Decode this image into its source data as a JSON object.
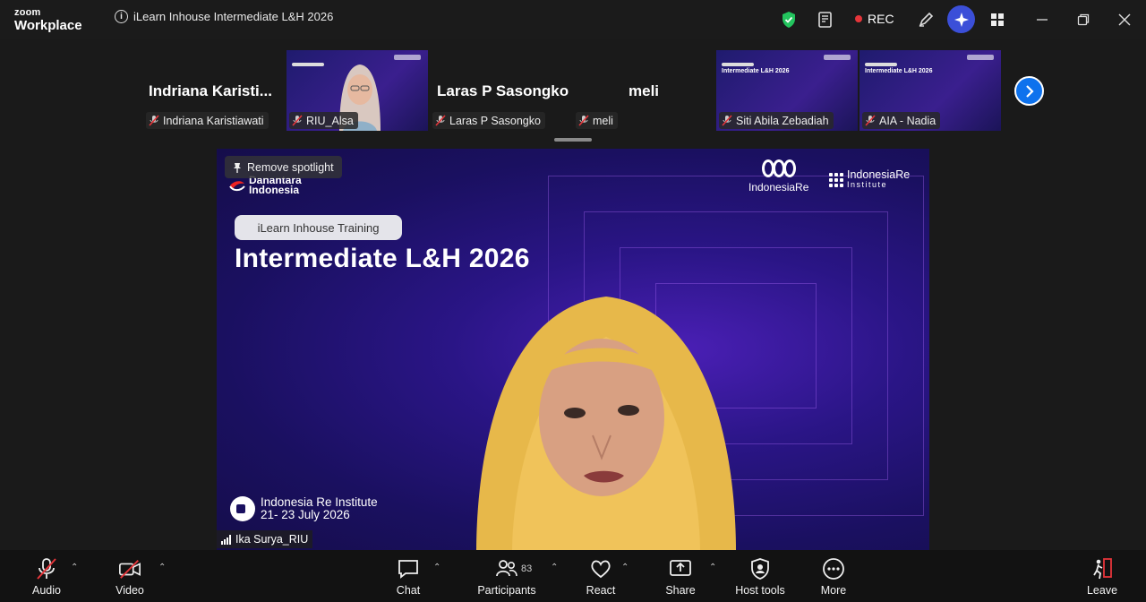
{
  "app": {
    "brand_line1": "zoom",
    "brand_line2": "Workplace",
    "meeting_title": "iLearn Inhouse Intermediate L&H 2026",
    "rec_label": "REC"
  },
  "participants_strip": [
    {
      "display": "Indriana  Karisti...",
      "label": "Indriana Karistiawati",
      "type": "name"
    },
    {
      "display": "",
      "label": "RIU_Alsa",
      "type": "video"
    },
    {
      "display": "Laras P Sasongko",
      "label": "Laras P Sasongko",
      "type": "name"
    },
    {
      "display": "meli",
      "label": "meli",
      "type": "name"
    },
    {
      "display": "",
      "label": "Siti Abila Zebadiah",
      "type": "slides",
      "slide_title": "Intermediate L&H 2026"
    },
    {
      "display": "",
      "label": "AIA - Nadia",
      "type": "slides",
      "slide_title": "Intermediate L&H 2026"
    }
  ],
  "main": {
    "spotlight_label": "Remove spotlight",
    "org_line1": "Danantara",
    "org_line2": "Indonesia",
    "pill_text": "iLearn Inhouse Training",
    "title": "Intermediate L&H 2026",
    "logo_indonesiare": "IndonesiaRe",
    "logo_institute_line1": "IndonesiaRe",
    "logo_institute_line2": "Institute",
    "event_line1": "Indonesia Re Institute",
    "event_line2": "21- 23 July 2026",
    "speaker_name": "Ika Surya_RIU"
  },
  "toolbar": {
    "audio": "Audio",
    "video": "Video",
    "chat": "Chat",
    "participants": "Participants",
    "participants_count": "83",
    "react": "React",
    "share": "Share",
    "host_tools": "Host tools",
    "more": "More",
    "leave": "Leave"
  },
  "colors": {
    "accent_blue": "#0e72ed",
    "rec_red": "#e5353a",
    "shield_green": "#23c45e",
    "ai_button": "#3b4fd8"
  }
}
